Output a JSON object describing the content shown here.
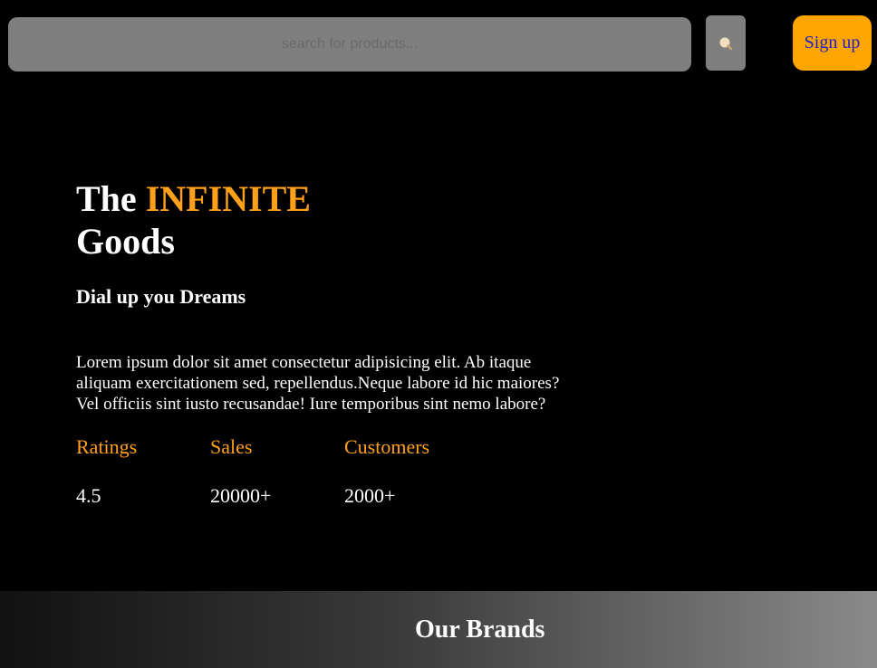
{
  "header": {
    "search": {
      "placeholder": "search for products...",
      "value": "",
      "button_icon": "search-icon"
    },
    "signup_label": "Sign up"
  },
  "hero": {
    "title_prefix": "The",
    "title_accent": "INFINITE",
    "title_suffix": "Goods",
    "subtitle": "Dial up you Dreams",
    "description": "Lorem ipsum dolor sit amet consectetur adipisicing elit. Ab itaque aliquam exercitationem sed, repellendus.Neque labore id hic maiores? Vel officiis sint iusto recusandae! Iure temporibus sint nemo labore?"
  },
  "stats": [
    {
      "label": "Ratings",
      "value": "4.5"
    },
    {
      "label": "Sales",
      "value": "20000+"
    },
    {
      "label": "Customers",
      "value": "2000+"
    }
  ],
  "brands": {
    "title": "Our Brands"
  },
  "colors": {
    "accent": "#ffa500",
    "accent_text": "#ffa01a",
    "background": "#000000",
    "search_bg": "#7f7f7f",
    "signup_text": "#2020c8"
  }
}
